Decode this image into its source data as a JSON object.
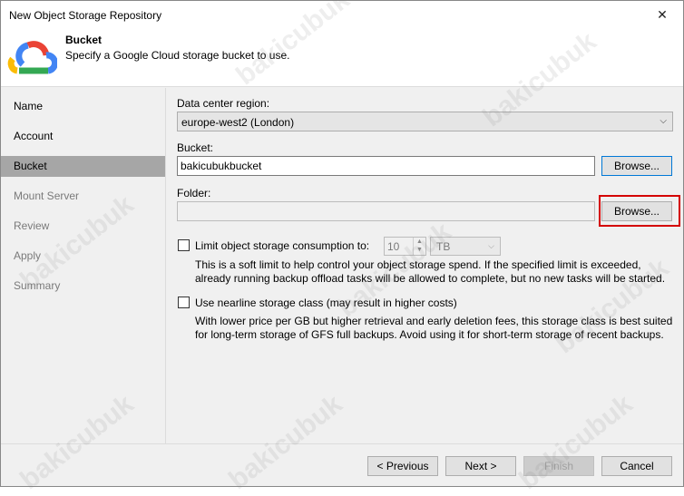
{
  "window": {
    "title": "New Object Storage Repository"
  },
  "header": {
    "title": "Bucket",
    "subtitle": "Specify a Google Cloud storage bucket to use."
  },
  "sidebar": {
    "items": [
      {
        "label": "Name"
      },
      {
        "label": "Account"
      },
      {
        "label": "Bucket"
      },
      {
        "label": "Mount Server"
      },
      {
        "label": "Review"
      },
      {
        "label": "Apply"
      },
      {
        "label": "Summary"
      }
    ],
    "active_index": 2
  },
  "form": {
    "region_label": "Data center region:",
    "region_value": "europe-west2 (London)",
    "bucket_label": "Bucket:",
    "bucket_value": "bakicubukbucket",
    "bucket_browse": "Browse...",
    "folder_label": "Folder:",
    "folder_value": "",
    "folder_browse": "Browse...",
    "limit_label": "Limit object storage consumption to:",
    "limit_checked": false,
    "limit_value": "10",
    "limit_unit": "TB",
    "limit_desc_line1": "This is a soft limit to help control your object storage spend. If the specified limit is exceeded,",
    "limit_desc_line2": "already running backup offload tasks will be allowed to complete, but no new tasks will be started.",
    "nearline_label": "Use nearline storage class (may result in higher costs)",
    "nearline_checked": false,
    "nearline_desc_line1": "With lower price per GB but higher retrieval and early deletion fees, this storage class is best suited",
    "nearline_desc_line2": "for long-term storage of GFS full backups. Avoid using it for short-term storage of recent backups."
  },
  "footer": {
    "previous": "< Previous",
    "next": "Next >",
    "finish": "Finish",
    "cancel": "Cancel"
  },
  "watermark": "bakicubuk",
  "colors": {
    "accent": "#0078d7",
    "highlight": "#d40000",
    "active_nav": "#a6a6a6"
  }
}
